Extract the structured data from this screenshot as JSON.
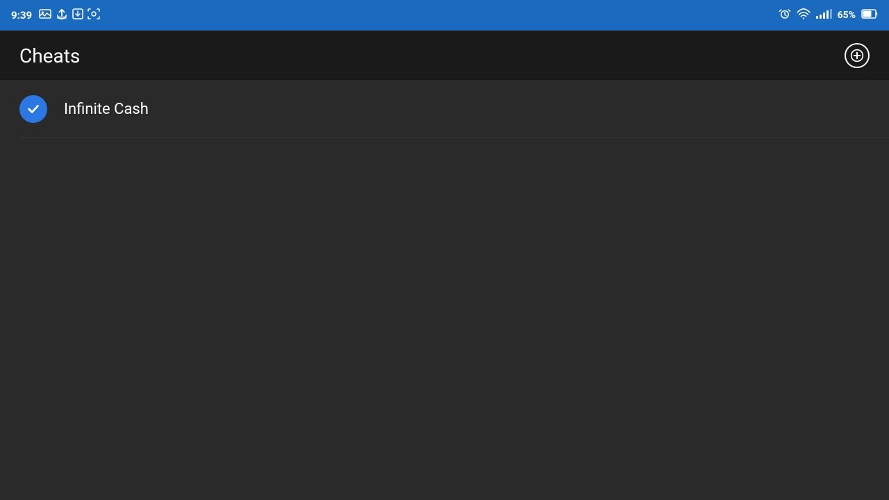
{
  "statusBar": {
    "time": "9:39",
    "battery": "65%",
    "batteryIcon": "battery-icon",
    "wifiIcon": "wifi-icon",
    "signalIcon": "signal-icon",
    "alarmIcon": "alarm-icon",
    "syncIcon": "sync-icon",
    "downloadIcon": "download-icon",
    "screenshotIcon": "screenshot-icon"
  },
  "appBar": {
    "title": "Cheats",
    "addButtonLabel": "Add"
  },
  "listItems": [
    {
      "id": 1,
      "label": "Infinite Cash",
      "checked": true
    }
  ],
  "colors": {
    "accent": "#2b78e4",
    "background": "#2a2a2a",
    "appBar": "#1a1a1a",
    "statusBar": "#1a6bbf",
    "divider": "#3a3a3a",
    "text": "#ffffff"
  }
}
